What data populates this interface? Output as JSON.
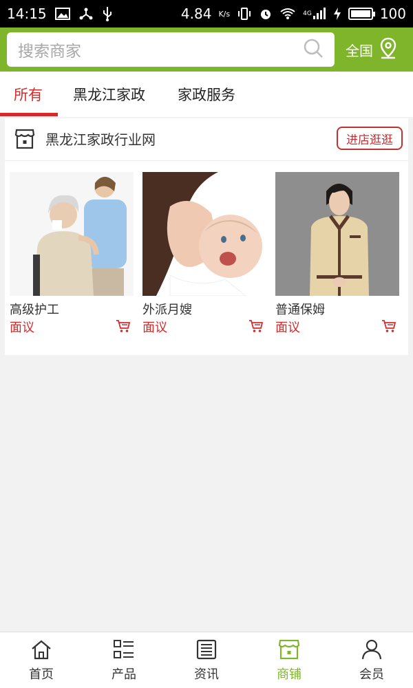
{
  "status_bar": {
    "time": "14:15",
    "speed": "4.84",
    "speed_unit": "K/s",
    "network": "4G",
    "battery": "100"
  },
  "search": {
    "placeholder": "搜索商家",
    "region": "全国"
  },
  "tabs": [
    {
      "label": "所有",
      "active": true
    },
    {
      "label": "黑龙江家政",
      "active": false
    },
    {
      "label": "家政服务",
      "active": false
    }
  ],
  "shop": {
    "name": "黑龙江家政行业网",
    "visit_label": "进店逛逛",
    "products": [
      {
        "name": "高级护工",
        "price": "面议"
      },
      {
        "name": "外派月嫂",
        "price": "面议"
      },
      {
        "name": "普通保姆",
        "price": "面议"
      }
    ]
  },
  "bottom_nav": [
    {
      "label": "首页",
      "icon": "home-icon",
      "active": false
    },
    {
      "label": "产品",
      "icon": "product-list-icon",
      "active": false
    },
    {
      "label": "资讯",
      "icon": "news-icon",
      "active": false
    },
    {
      "label": "商铺",
      "icon": "shop-icon",
      "active": true
    },
    {
      "label": "会员",
      "icon": "member-icon",
      "active": false
    }
  ],
  "colors": {
    "brand_green": "#7fb52a",
    "accent_red": "#d42a2a"
  }
}
